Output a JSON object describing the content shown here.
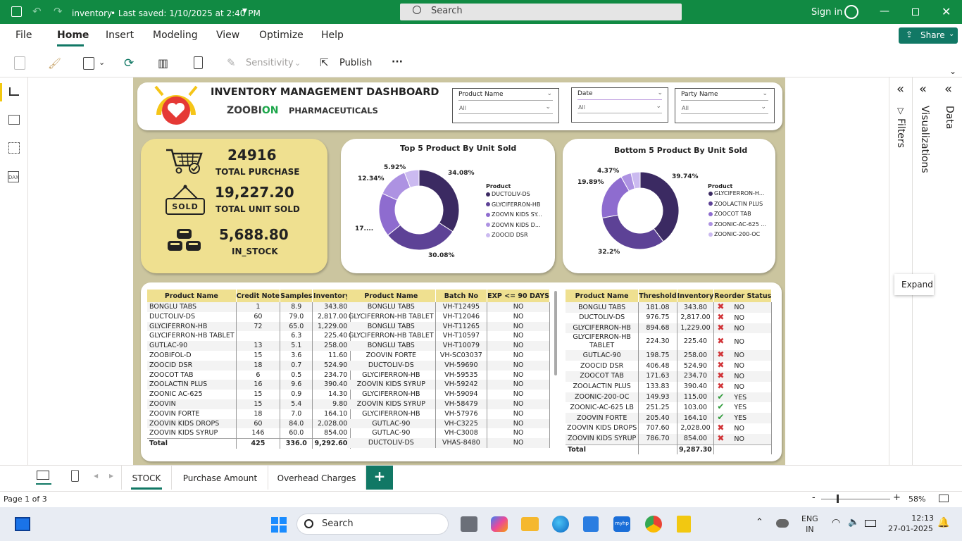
{
  "titlebar": {
    "file": "inventory",
    "saved": "• Last saved: 1/10/2025 at 2:40 PM",
    "search_placeholder": "Search",
    "signin": "Sign in"
  },
  "menu": {
    "file": "File",
    "home": "Home",
    "insert": "Insert",
    "modeling": "Modeling",
    "view": "View",
    "optimize": "Optimize",
    "help": "Help",
    "share": "Share"
  },
  "ribbon": {
    "sensitivity": "Sensitivity",
    "publish": "Publish",
    "more": "···"
  },
  "header": {
    "title": "INVENTORY MANAGEMENT DASHBOARD",
    "brand_a": "ZOOBI",
    "brand_b": "ON",
    "subtitle": "PHARMACEUTICALS"
  },
  "slicers": [
    {
      "label": "Product Name",
      "value": "All"
    },
    {
      "label": "Date",
      "value": "All"
    },
    {
      "label": "Party Name",
      "value": "All"
    }
  ],
  "kpis": [
    {
      "value": "24916",
      "label": "TOTAL PURCHASE"
    },
    {
      "value": "19,227.20",
      "label": "TOTAL UNIT SOLD"
    },
    {
      "value": "5,688.80",
      "label": "IN_STOCK"
    }
  ],
  "sold_sign": "SOLD",
  "chart_data": [
    {
      "type": "pie",
      "title": "Top 5 Product By Unit Sold",
      "legend_title": "Product",
      "legend_position": "right",
      "categories": [
        "DUCTOLIV-DS",
        "GLYCIFERRON-HB",
        "ZOOVIN KIDS SY...",
        "ZOOVIN KIDS D...",
        "ZOOCID DSR"
      ],
      "values": [
        34.08,
        30.08,
        17.58,
        12.34,
        5.92
      ],
      "labels": [
        "34.08%",
        "30.08%",
        "17....",
        "12.34%",
        "5.92%"
      ],
      "colors": [
        "#3b2a62",
        "#5d4296",
        "#8e6ccf",
        "#ad92e2",
        "#cbbaf0"
      ]
    },
    {
      "type": "pie",
      "title": "Bottom 5 Product By Unit Sold",
      "legend_title": "Product",
      "legend_position": "right",
      "categories": [
        "GLYCIFERRON-H...",
        "ZOOLACTIN PLUS",
        "ZOOCOT TAB",
        "ZOONIC-AC-625 ...",
        "ZOONIC-200-OC"
      ],
      "values": [
        39.74,
        32.2,
        19.89,
        4.37,
        3.8
      ],
      "labels": [
        "39.74%",
        "32.2%",
        "19.89%",
        "4.37%",
        ""
      ],
      "colors": [
        "#3b2a62",
        "#5d4296",
        "#8e6ccf",
        "#ad92e2",
        "#cbbaf0"
      ]
    }
  ],
  "table1": {
    "headers": [
      "Product Name",
      "Credit Note",
      "Samples",
      "Inventory"
    ],
    "rows": [
      [
        "BONGLU TABS",
        "1",
        "8.9",
        "343.80"
      ],
      [
        "DUCTOLIV-DS",
        "60",
        "79.0",
        "2,817.00"
      ],
      [
        "GLYCIFERRON-HB",
        "72",
        "65.0",
        "1,229.00"
      ],
      [
        "GLYCIFERRON-HB TABLET",
        "",
        "6.3",
        "225.40"
      ],
      [
        "GUTLAC-90",
        "13",
        "5.1",
        "258.00"
      ],
      [
        "ZOOBIFOL-D",
        "15",
        "3.6",
        "11.60"
      ],
      [
        "ZOOCID DSR",
        "18",
        "0.7",
        "524.90"
      ],
      [
        "ZOOCOT TAB",
        "6",
        "0.5",
        "234.70"
      ],
      [
        "ZOOLACTIN PLUS",
        "16",
        "9.6",
        "390.40"
      ],
      [
        "ZOONIC AC-625",
        "15",
        "0.9",
        "14.30"
      ],
      [
        "ZOOVIN",
        "15",
        "5.4",
        "9.80"
      ],
      [
        "ZOOVIN FORTE",
        "18",
        "7.0",
        "164.10"
      ],
      [
        "ZOOVIN KIDS DROPS",
        "60",
        "84.0",
        "2,028.00"
      ],
      [
        "ZOOVIN KIDS SYRUP",
        "146",
        "60.0",
        "854.00"
      ]
    ],
    "total": [
      "Total",
      "425",
      "336.0",
      "9,292.60"
    ]
  },
  "table2": {
    "headers": [
      "Product Name",
      "Batch No",
      "EXP <= 90 DAYS"
    ],
    "rows": [
      [
        "BONGLU TABS",
        "VH-T12495",
        "NO"
      ],
      [
        "GLYCIFERRON-HB TABLET",
        "VH-T12046",
        "NO"
      ],
      [
        "BONGLU TABS",
        "VH-T11265",
        "NO"
      ],
      [
        "GLYCIFERRON-HB TABLET",
        "VH-T10597",
        "NO"
      ],
      [
        "BONGLU TABS",
        "VH-T10079",
        "NO"
      ],
      [
        "ZOOVIN FORTE",
        "VH-SC03037",
        "NO"
      ],
      [
        "DUCTOLIV-DS",
        "VH-59690",
        "NO"
      ],
      [
        "GLYCIFERRON-HB",
        "VH-59535",
        "NO"
      ],
      [
        "ZOOVIN KIDS SYRUP",
        "VH-59242",
        "NO"
      ],
      [
        "GLYCIFERRON-HB",
        "VH-59094",
        "NO"
      ],
      [
        "ZOOVIN KIDS SYRUP",
        "VH-58479",
        "NO"
      ],
      [
        "GLYCIFERRON-HB",
        "VH-57976",
        "NO"
      ],
      [
        "GUTLAC-90",
        "VH-C3225",
        "NO"
      ],
      [
        "GUTLAC-90",
        "VH-C3008",
        "NO"
      ],
      [
        "DUCTOLIV-DS",
        "VHAS-8480",
        "NO"
      ]
    ]
  },
  "table3": {
    "headers": [
      "Product Name",
      "Threshold",
      "Inventory",
      "Reorder Status"
    ],
    "rows": [
      [
        "BONGLU TABS",
        "181.08",
        "343.80",
        "NO"
      ],
      [
        "DUCTOLIV-DS",
        "976.75",
        "2,817.00",
        "NO"
      ],
      [
        "GLYCIFERRON-HB",
        "894.68",
        "1,229.00",
        "NO"
      ],
      [
        "GLYCIFERRON-HB TABLET",
        "224.30",
        "225.40",
        "NO"
      ],
      [
        "GUTLAC-90",
        "198.75",
        "258.00",
        "NO"
      ],
      [
        "ZOOCID DSR",
        "406.48",
        "524.90",
        "NO"
      ],
      [
        "ZOOCOT TAB",
        "171.63",
        "234.70",
        "NO"
      ],
      [
        "ZOOLACTIN PLUS",
        "133.83",
        "390.40",
        "NO"
      ],
      [
        "ZOONIC-200-OC",
        "149.93",
        "115.00",
        "YES"
      ],
      [
        "ZOONIC-AC-625 LB",
        "251.25",
        "103.00",
        "YES"
      ],
      [
        "ZOOVIN FORTE",
        "205.40",
        "164.10",
        "YES"
      ],
      [
        "ZOOVIN KIDS DROPS",
        "707.60",
        "2,028.00",
        "NO"
      ],
      [
        "ZOOVIN KIDS SYRUP",
        "786.70",
        "854.00",
        "NO"
      ]
    ],
    "total": [
      "Total",
      "",
      "9,287.30",
      ""
    ]
  },
  "panes": {
    "filters": "Filters",
    "visualizations": "Visualizations",
    "data": "Data",
    "expand": "Expand"
  },
  "pages": [
    "STOCK",
    "Purchase Amount",
    "Overhead Charges"
  ],
  "status": {
    "page": "Page 1 of 3",
    "zoom": "58%"
  },
  "taskbar": {
    "search": "Search",
    "lang1": "ENG",
    "lang2": "IN",
    "time": "12:13",
    "date": "27-01-2025"
  }
}
